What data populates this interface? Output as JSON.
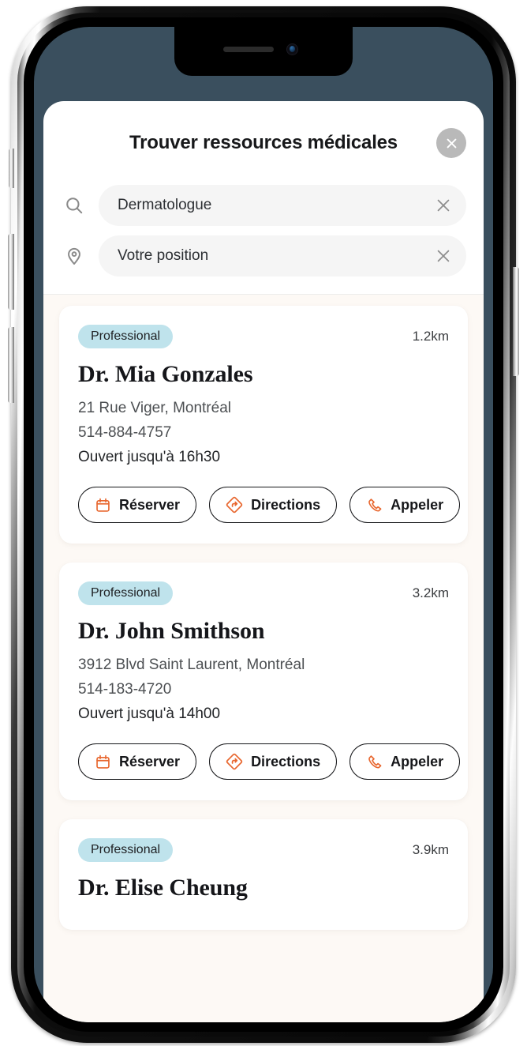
{
  "device": {
    "type": "phone-mockup",
    "status_bar_background": "#3a4f5e"
  },
  "sheet": {
    "title": "Trouver ressources médicales",
    "close_icon": "close-icon"
  },
  "search": {
    "query_field": {
      "icon": "search-icon",
      "value": "Dermatologue",
      "placeholder": "Dermatologue",
      "clear_icon": "close-icon"
    },
    "location_field": {
      "icon": "location-pin-icon",
      "value": "Votre position",
      "placeholder": "Votre position",
      "clear_icon": "close-icon"
    }
  },
  "colors": {
    "badge_background": "#bfe3ec",
    "accent_orange": "#e8672f",
    "list_background": "#fdf9f5",
    "card_background": "#ffffff",
    "screen_background": "#3a4f5e"
  },
  "actions": {
    "book": {
      "label": "Réserver",
      "icon": "calendar-icon"
    },
    "directions": {
      "label": "Directions",
      "icon": "directions-sign-icon"
    },
    "call": {
      "label": "Appeler",
      "icon": "phone-icon"
    }
  },
  "results": [
    {
      "badge": "Professional",
      "distance": "1.2km",
      "name": "Dr. Mia Gonzales",
      "address": "21 Rue Viger, Montréal",
      "phone": "514-884-4757",
      "hours": "Ouvert jusqu'à 16h30"
    },
    {
      "badge": "Professional",
      "distance": "3.2km",
      "name": "Dr. John Smithson",
      "address": "3912 Blvd Saint Laurent, Montréal",
      "phone": "514-183-4720",
      "hours": "Ouvert jusqu'à 14h00"
    },
    {
      "badge": "Professional",
      "distance": "3.9km",
      "name": "Dr. Elise Cheung",
      "address": "",
      "phone": "",
      "hours": ""
    }
  ]
}
